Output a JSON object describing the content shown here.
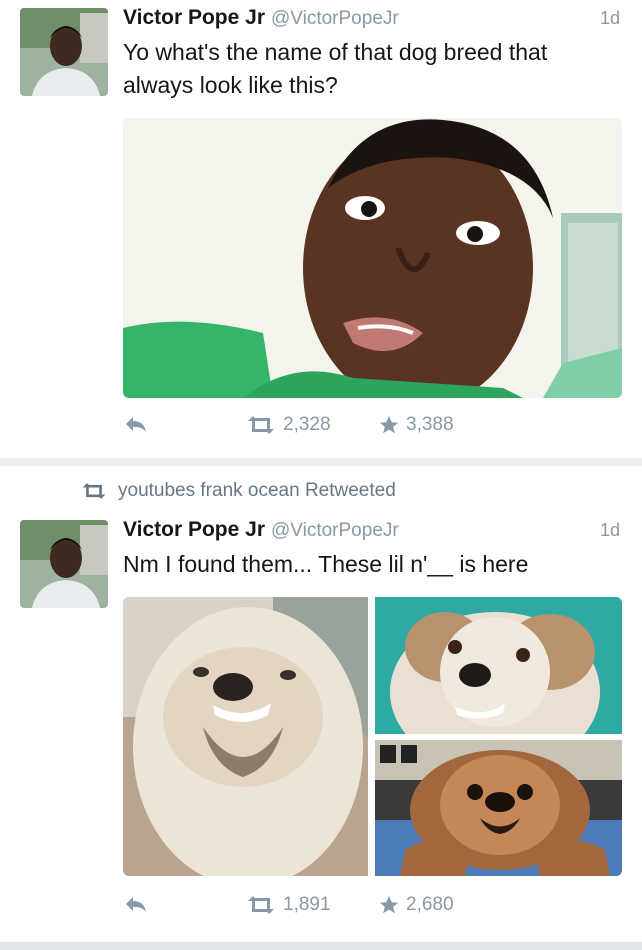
{
  "tweets": [
    {
      "display_name": "Victor Pope Jr",
      "handle": "@VictorPopeJr",
      "time": "1d",
      "text": "Yo what's the name of that dog breed that always look like this?",
      "retweets": "2,328",
      "likes": "3,388"
    },
    {
      "retweeted_by": "youtubes frank ocean Retweeted",
      "display_name": "Victor Pope Jr",
      "handle": "@VictorPopeJr",
      "time": "1d",
      "text": "Nm I found them... These lil n'__ is here",
      "retweets": "1,891",
      "likes": "2,680"
    }
  ],
  "icons": {
    "reply": "reply-icon",
    "retweet": "retweet-icon",
    "like": "star-icon"
  },
  "colors": {
    "name": "#14171a",
    "meta": "#8899a6",
    "background": "#eceef0"
  }
}
